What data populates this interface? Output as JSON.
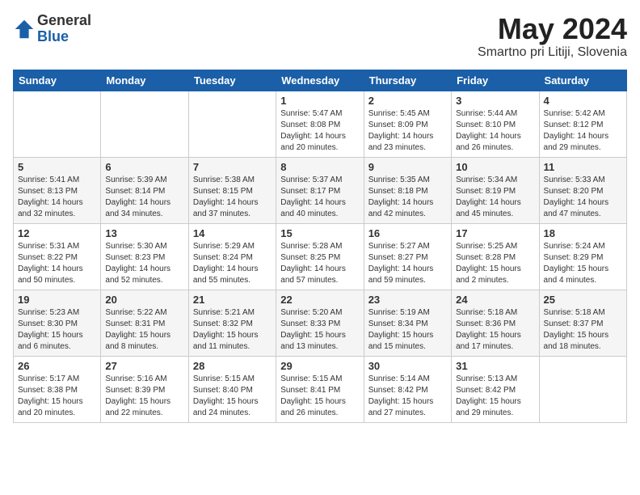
{
  "header": {
    "logo_general": "General",
    "logo_blue": "Blue",
    "month_year": "May 2024",
    "location": "Smartno pri Litiji, Slovenia"
  },
  "weekdays": [
    "Sunday",
    "Monday",
    "Tuesday",
    "Wednesday",
    "Thursday",
    "Friday",
    "Saturday"
  ],
  "weeks": [
    [
      {
        "day": "",
        "info": ""
      },
      {
        "day": "",
        "info": ""
      },
      {
        "day": "",
        "info": ""
      },
      {
        "day": "1",
        "info": "Sunrise: 5:47 AM\nSunset: 8:08 PM\nDaylight: 14 hours\nand 20 minutes."
      },
      {
        "day": "2",
        "info": "Sunrise: 5:45 AM\nSunset: 8:09 PM\nDaylight: 14 hours\nand 23 minutes."
      },
      {
        "day": "3",
        "info": "Sunrise: 5:44 AM\nSunset: 8:10 PM\nDaylight: 14 hours\nand 26 minutes."
      },
      {
        "day": "4",
        "info": "Sunrise: 5:42 AM\nSunset: 8:12 PM\nDaylight: 14 hours\nand 29 minutes."
      }
    ],
    [
      {
        "day": "5",
        "info": "Sunrise: 5:41 AM\nSunset: 8:13 PM\nDaylight: 14 hours\nand 32 minutes."
      },
      {
        "day": "6",
        "info": "Sunrise: 5:39 AM\nSunset: 8:14 PM\nDaylight: 14 hours\nand 34 minutes."
      },
      {
        "day": "7",
        "info": "Sunrise: 5:38 AM\nSunset: 8:15 PM\nDaylight: 14 hours\nand 37 minutes."
      },
      {
        "day": "8",
        "info": "Sunrise: 5:37 AM\nSunset: 8:17 PM\nDaylight: 14 hours\nand 40 minutes."
      },
      {
        "day": "9",
        "info": "Sunrise: 5:35 AM\nSunset: 8:18 PM\nDaylight: 14 hours\nand 42 minutes."
      },
      {
        "day": "10",
        "info": "Sunrise: 5:34 AM\nSunset: 8:19 PM\nDaylight: 14 hours\nand 45 minutes."
      },
      {
        "day": "11",
        "info": "Sunrise: 5:33 AM\nSunset: 8:20 PM\nDaylight: 14 hours\nand 47 minutes."
      }
    ],
    [
      {
        "day": "12",
        "info": "Sunrise: 5:31 AM\nSunset: 8:22 PM\nDaylight: 14 hours\nand 50 minutes."
      },
      {
        "day": "13",
        "info": "Sunrise: 5:30 AM\nSunset: 8:23 PM\nDaylight: 14 hours\nand 52 minutes."
      },
      {
        "day": "14",
        "info": "Sunrise: 5:29 AM\nSunset: 8:24 PM\nDaylight: 14 hours\nand 55 minutes."
      },
      {
        "day": "15",
        "info": "Sunrise: 5:28 AM\nSunset: 8:25 PM\nDaylight: 14 hours\nand 57 minutes."
      },
      {
        "day": "16",
        "info": "Sunrise: 5:27 AM\nSunset: 8:27 PM\nDaylight: 14 hours\nand 59 minutes."
      },
      {
        "day": "17",
        "info": "Sunrise: 5:25 AM\nSunset: 8:28 PM\nDaylight: 15 hours\nand 2 minutes."
      },
      {
        "day": "18",
        "info": "Sunrise: 5:24 AM\nSunset: 8:29 PM\nDaylight: 15 hours\nand 4 minutes."
      }
    ],
    [
      {
        "day": "19",
        "info": "Sunrise: 5:23 AM\nSunset: 8:30 PM\nDaylight: 15 hours\nand 6 minutes."
      },
      {
        "day": "20",
        "info": "Sunrise: 5:22 AM\nSunset: 8:31 PM\nDaylight: 15 hours\nand 8 minutes."
      },
      {
        "day": "21",
        "info": "Sunrise: 5:21 AM\nSunset: 8:32 PM\nDaylight: 15 hours\nand 11 minutes."
      },
      {
        "day": "22",
        "info": "Sunrise: 5:20 AM\nSunset: 8:33 PM\nDaylight: 15 hours\nand 13 minutes."
      },
      {
        "day": "23",
        "info": "Sunrise: 5:19 AM\nSunset: 8:34 PM\nDaylight: 15 hours\nand 15 minutes."
      },
      {
        "day": "24",
        "info": "Sunrise: 5:18 AM\nSunset: 8:36 PM\nDaylight: 15 hours\nand 17 minutes."
      },
      {
        "day": "25",
        "info": "Sunrise: 5:18 AM\nSunset: 8:37 PM\nDaylight: 15 hours\nand 18 minutes."
      }
    ],
    [
      {
        "day": "26",
        "info": "Sunrise: 5:17 AM\nSunset: 8:38 PM\nDaylight: 15 hours\nand 20 minutes."
      },
      {
        "day": "27",
        "info": "Sunrise: 5:16 AM\nSunset: 8:39 PM\nDaylight: 15 hours\nand 22 minutes."
      },
      {
        "day": "28",
        "info": "Sunrise: 5:15 AM\nSunset: 8:40 PM\nDaylight: 15 hours\nand 24 minutes."
      },
      {
        "day": "29",
        "info": "Sunrise: 5:15 AM\nSunset: 8:41 PM\nDaylight: 15 hours\nand 26 minutes."
      },
      {
        "day": "30",
        "info": "Sunrise: 5:14 AM\nSunset: 8:42 PM\nDaylight: 15 hours\nand 27 minutes."
      },
      {
        "day": "31",
        "info": "Sunrise: 5:13 AM\nSunset: 8:42 PM\nDaylight: 15 hours\nand 29 minutes."
      },
      {
        "day": "",
        "info": ""
      }
    ]
  ]
}
